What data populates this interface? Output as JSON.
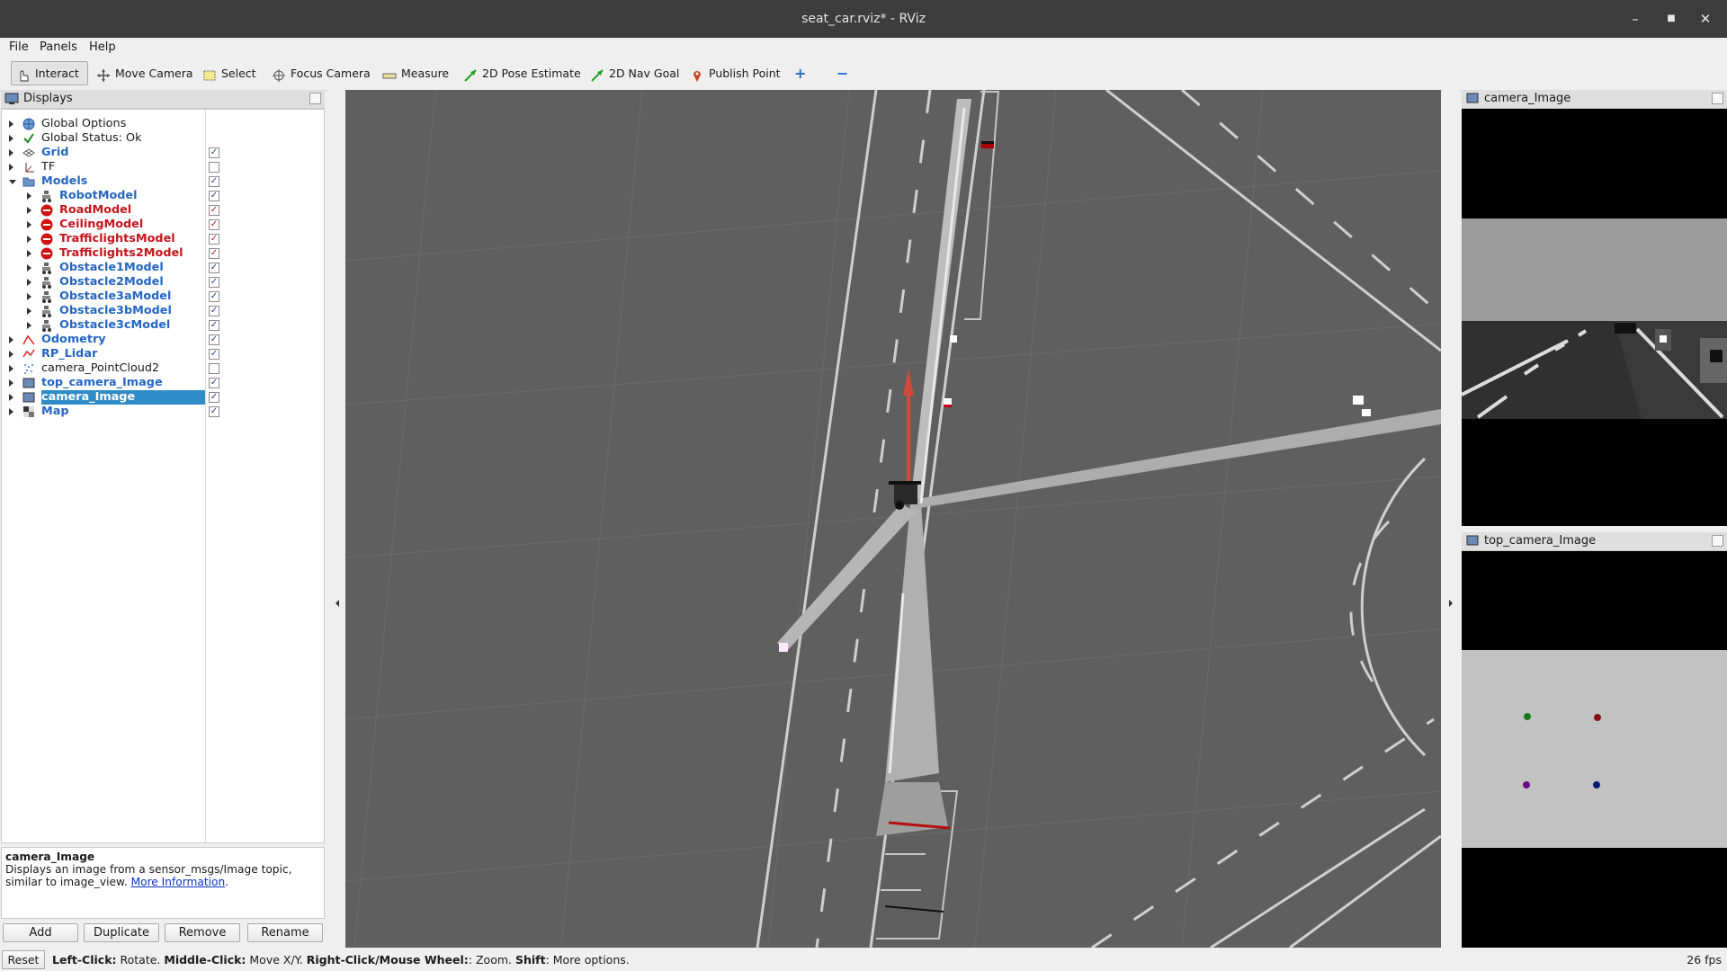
{
  "window": {
    "title": "seat_car.rviz* - RViz",
    "minimize": "–",
    "maximize": "■",
    "close": "✕"
  },
  "menu": {
    "file": "File",
    "panels": "Panels",
    "help": "Help"
  },
  "toolbar": {
    "interact": "Interact",
    "move_camera": "Move Camera",
    "select": "Select",
    "focus_camera": "Focus Camera",
    "measure": "Measure",
    "pose_estimate": "2D Pose Estimate",
    "nav_goal": "2D Nav Goal",
    "publish_point": "Publish Point",
    "add_tool": "+",
    "remove_tool": "−"
  },
  "displays": {
    "title": "Displays",
    "items": [
      {
        "label": "Global Options",
        "style": "normal",
        "checkbox": "none",
        "icon": "globe-icon"
      },
      {
        "label": "Global Status: Ok",
        "style": "normal",
        "checkbox": "none",
        "icon": "checkmark-icon"
      },
      {
        "label": "Grid",
        "style": "blue",
        "checkbox": "checked",
        "icon": "grid-icon"
      },
      {
        "label": "TF",
        "style": "normal",
        "checkbox": "unchecked",
        "icon": "axes-icon"
      },
      {
        "label": "Models",
        "style": "blue",
        "checkbox": "checked",
        "icon": "folder-icon"
      },
      {
        "label": "RobotModel",
        "style": "blue",
        "checkbox": "checked",
        "icon": "robot-icon"
      },
      {
        "label": "RoadModel",
        "style": "red",
        "checkbox": "checked-red",
        "icon": "error-icon"
      },
      {
        "label": "CeilingModel",
        "style": "red",
        "checkbox": "checked-red",
        "icon": "error-icon"
      },
      {
        "label": "TrafficlightsModel",
        "style": "red",
        "checkbox": "checked-red",
        "icon": "error-icon"
      },
      {
        "label": "Trafficlights2Model",
        "style": "red",
        "checkbox": "checked-red",
        "icon": "error-icon"
      },
      {
        "label": "Obstacle1Model",
        "style": "blue",
        "checkbox": "checked",
        "icon": "robot-icon"
      },
      {
        "label": "Obstacle2Model",
        "style": "blue",
        "checkbox": "checked",
        "icon": "robot-icon"
      },
      {
        "label": "Obstacle3aModel",
        "style": "blue",
        "checkbox": "checked",
        "icon": "robot-icon"
      },
      {
        "label": "Obstacle3bModel",
        "style": "blue",
        "checkbox": "checked",
        "icon": "robot-icon"
      },
      {
        "label": "Obstacle3cModel",
        "style": "blue",
        "checkbox": "checked",
        "icon": "robot-icon"
      },
      {
        "label": "Odometry",
        "style": "blue",
        "checkbox": "checked",
        "icon": "odometry-icon"
      },
      {
        "label": "RP_Lidar",
        "style": "blue",
        "checkbox": "checked",
        "icon": "laser-icon"
      },
      {
        "label": "camera_PointCloud2",
        "style": "normal",
        "checkbox": "unchecked",
        "icon": "pointcloud-icon"
      },
      {
        "label": "top_camera_Image",
        "style": "blue",
        "checkbox": "checked",
        "icon": "image-icon"
      },
      {
        "label": "camera_Image",
        "style": "selected",
        "checkbox": "checked",
        "icon": "image-icon"
      },
      {
        "label": "Map",
        "style": "blue",
        "checkbox": "checked",
        "icon": "map-icon"
      }
    ]
  },
  "description": {
    "title": "camera_Image",
    "text": "Displays an image from a sensor_msgs/Image topic, similar to image_view.",
    "link": "More Information",
    "suffix": "."
  },
  "buttons": {
    "add": "Add",
    "duplicate": "Duplicate",
    "remove": "Remove",
    "rename": "Rename"
  },
  "camera_panel": {
    "title": "camera_Image"
  },
  "top_camera_panel": {
    "title": "top_camera_Image"
  },
  "status": {
    "reset": "Reset",
    "hint_left_key": "Left-Click:",
    "hint_left": " Rotate. ",
    "hint_middle_key": "Middle-Click:",
    "hint_middle": " Move X/Y. ",
    "hint_right_key": "Right-Click/Mouse Wheel:",
    "hint_right": ": Zoom. ",
    "hint_shift_key": "Shift",
    "hint_shift": ": More options.",
    "fps": "26 fps"
  },
  "colors": {
    "selection": "#308cc6",
    "property_blue": "#2466c2",
    "error_red": "#c4161c",
    "viewport_bg": "#5f5f5f"
  }
}
